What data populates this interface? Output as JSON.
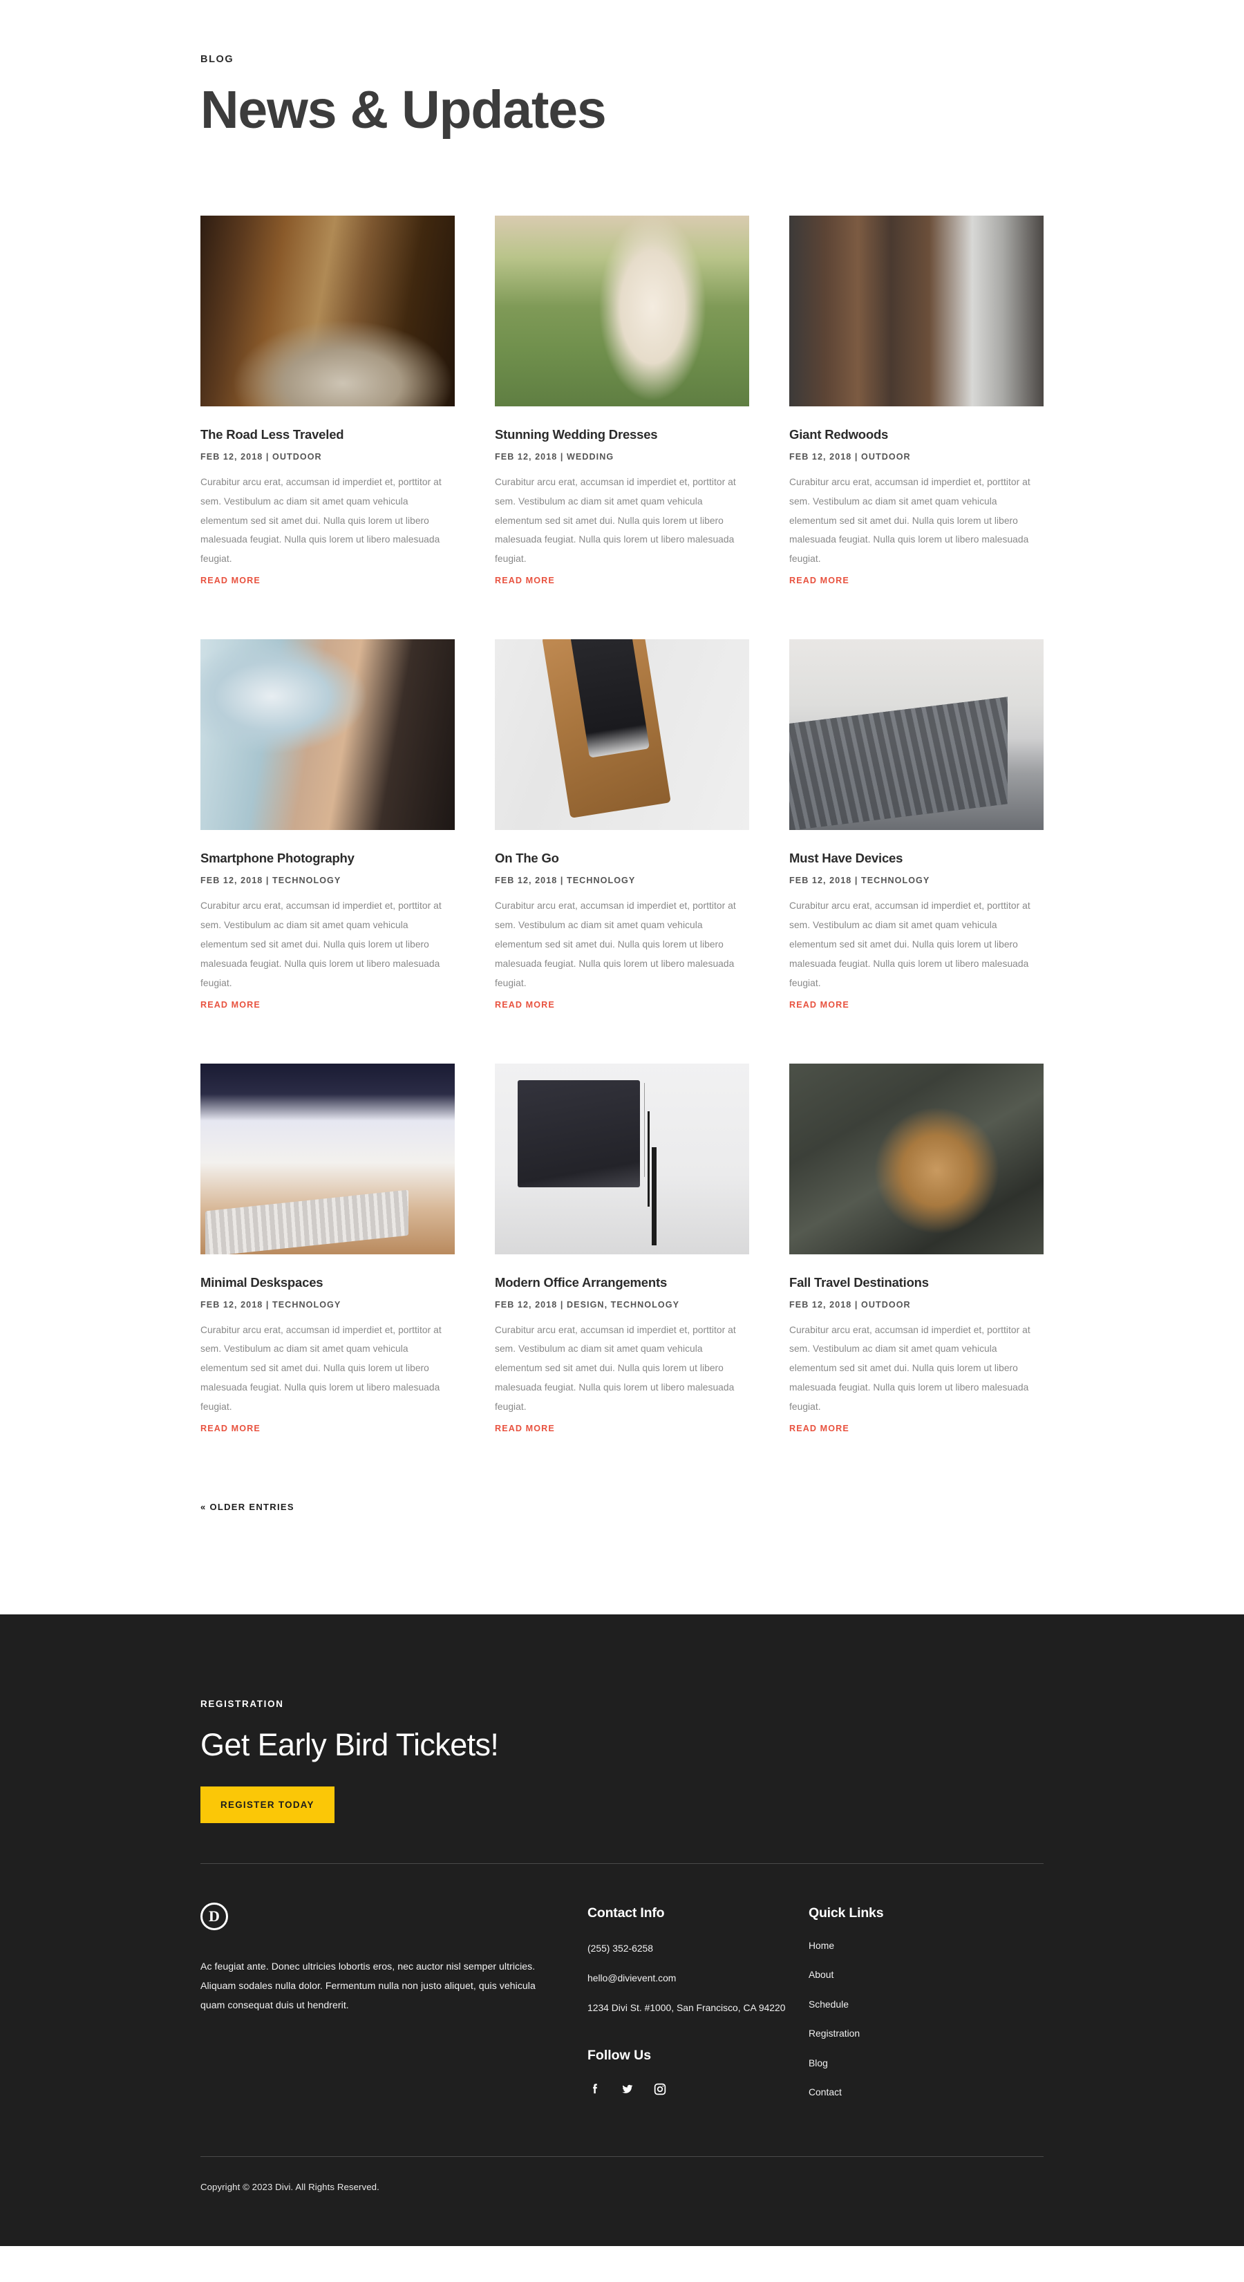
{
  "hero": {
    "eyebrow": "BLOG",
    "title": "News & Updates"
  },
  "blog": {
    "excerpt": "Curabitur arcu erat, accumsan id imperdiet et, porttitor at sem. Vestibulum ac diam sit amet quam vehicula elementum sed sit amet dui. Nulla quis lorem ut libero malesuada feugiat. Nulla quis lorem ut libero malesuada feugiat.",
    "read_more": "READ MORE",
    "posts": [
      {
        "title": "The Road Less Traveled",
        "meta": "FEB 12, 2018 | OUTDOOR",
        "image": "autumn-forest-road-photo"
      },
      {
        "title": "Stunning Wedding Dresses",
        "meta": "FEB 12, 2018 | WEDDING",
        "image": "bride-in-wedding-dress-photo"
      },
      {
        "title": "Giant Redwoods",
        "meta": "FEB 12, 2018 | OUTDOOR",
        "image": "giant-redwood-trees-photo"
      },
      {
        "title": "Smartphone Photography",
        "meta": "FEB 12, 2018 | TECHNOLOGY",
        "image": "hands-holding-camera-photo"
      },
      {
        "title": "On The Go",
        "meta": "FEB 12, 2018 | TECHNOLOGY",
        "image": "tablet-stylus-leather-case-photo"
      },
      {
        "title": "Must Have Devices",
        "meta": "FEB 12, 2018 | TECHNOLOGY",
        "image": "laptop-keyboard-desk-photo"
      },
      {
        "title": "Minimal Deskspaces",
        "meta": "FEB 12, 2018 | TECHNOLOGY",
        "image": "wireless-keyboard-desk-photo"
      },
      {
        "title": "Modern Office Arrangements",
        "meta": "FEB 12, 2018 | DESIGN, TECHNOLOGY",
        "image": "imac-desk-lamp-office-photo"
      },
      {
        "title": "Fall Travel Destinations",
        "meta": "FEB 12, 2018 | OUTDOOR",
        "image": "pinecone-closeup-photo"
      }
    ],
    "pagination": {
      "older_entries": "« OLDER ENTRIES"
    }
  },
  "cta": {
    "eyebrow": "REGISTRATION",
    "title": "Get Early Bird Tickets!",
    "button": "REGISTER TODAY",
    "button_color": "#fbc707"
  },
  "footer": {
    "logo_letter": "D",
    "about": "Ac feugiat ante. Donec ultricies lobortis eros, nec auctor nisl semper ultricies. Aliquam sodales nulla dolor. Fermentum nulla non justo aliquet, quis vehicula quam consequat duis ut hendrerit.",
    "contact": {
      "heading": "Contact Info",
      "phone": "(255) 352-6258",
      "email": "hello@divievent.com",
      "address": "1234 Divi St. #1000, San Francisco, CA 94220"
    },
    "follow": {
      "heading": "Follow Us",
      "socials": [
        "facebook-icon",
        "twitter-icon",
        "instagram-icon"
      ]
    },
    "quick_links": {
      "heading": "Quick Links",
      "items": [
        "Home",
        "About",
        "Schedule",
        "Registration",
        "Blog",
        "Contact"
      ]
    },
    "copyright": "Copyright © 2023 Divi. All Rights Reserved.",
    "background_color": "#1f1f1f",
    "accent_color": "#e8523f"
  }
}
